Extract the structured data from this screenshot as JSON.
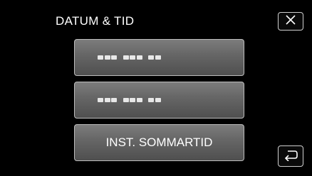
{
  "screen": {
    "title": "DATUM & TID"
  },
  "header": {
    "close_icon": "close-icon"
  },
  "menu": {
    "items": [
      {
        "label": "",
        "state": "obscured-placeholder"
      },
      {
        "label": "",
        "state": "obscured-placeholder"
      },
      {
        "label": "INST. SOMMARTID"
      }
    ]
  },
  "footer": {
    "back_icon": "return-arrow-icon"
  },
  "colors": {
    "background": "#000000",
    "button_top": "#7c7c7c",
    "button_bottom": "#4f4f4f",
    "text": "#ffffff"
  }
}
